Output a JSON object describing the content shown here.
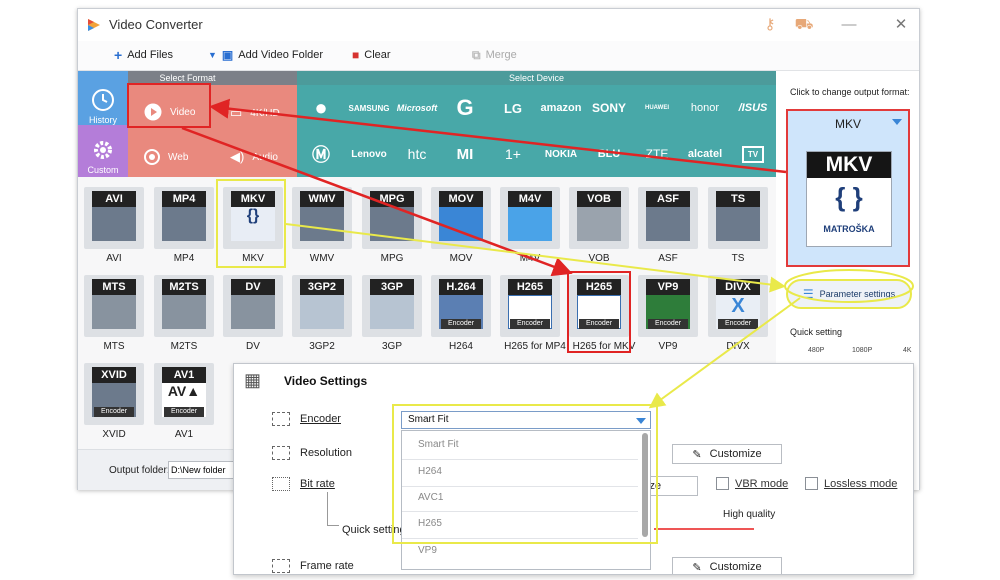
{
  "window": {
    "title": "Video Converter"
  },
  "toolbar": {
    "add_files": "Add Files",
    "add_video_folder": "Add Video Folder",
    "clear": "Clear",
    "merge": "Merge"
  },
  "format_panel": {
    "select_format": "Select Format",
    "select_device": "Select Device",
    "history": "History",
    "custom": "Custom",
    "video": "Video",
    "hd": "4K/HD",
    "web": "Web",
    "audio": "Audio"
  },
  "devices_row1": [
    "SAMSUNG",
    "Microsoft",
    "G",
    "LG",
    "amazon",
    "SONY",
    "HUAWEI",
    "honor",
    "/ISUS"
  ],
  "devices_row2": [
    "Lenovo",
    "htc",
    "MI",
    "1+",
    "NOKIA",
    "BLU",
    "ZTE",
    "alcatel",
    "TV"
  ],
  "formats_row1": [
    "AVI",
    "MP4",
    "MKV",
    "WMV",
    "MPG",
    "MOV",
    "M4V",
    "VOB",
    "ASF",
    "TS"
  ],
  "formats_row2": [
    "MTS",
    "M2TS",
    "DV",
    "3GP2",
    "3GP",
    "H264",
    "H265 for MP4",
    "H265 for MKV",
    "VP9",
    "DIVX"
  ],
  "formats_row2_tags": [
    "MTS",
    "M2TS",
    "DV",
    "3GP2",
    "3GP",
    "H.264",
    "H265",
    "H265",
    "VP9",
    "DIVX"
  ],
  "formats_row3": [
    "XVID",
    "AV1"
  ],
  "bottom": {
    "output_folder_label": "Output folder:",
    "output_folder_value": "D:\\New folder"
  },
  "right_panel": {
    "click_to_change": "Click to change output format:",
    "current_format": "MKV",
    "mkv_tag": "MKV",
    "mkv_sub": "MATROŠKA",
    "parameter_settings": "Parameter settings",
    "quick_setting": "Quick setting",
    "ticks": [
      "480P",
      "1080P",
      "4K"
    ]
  },
  "settings": {
    "title": "Video Settings",
    "encoder_label": "Encoder",
    "resolution_label": "Resolution",
    "bitrate_label": "Bit rate",
    "quick_setting_label": "Quick setting",
    "framerate_label": "Frame rate",
    "encoder_value": "Smart Fit",
    "encoder_options": [
      "Smart Fit",
      "H264",
      "AVC1",
      "H265",
      "VP9"
    ],
    "customize": "Customize",
    "ize_suffix": "ize",
    "vbr_mode": "VBR mode",
    "lossless_mode": "Lossless mode",
    "high_quality": "High quality"
  },
  "colors": {
    "history_bg": "#5aa1e2",
    "custom_bg": "#b47dd9",
    "format_red": "#e9897e",
    "device_teal": "#48a8a8",
    "highlight_red": "#e02424",
    "highlight_yellow": "#e9e94a"
  }
}
